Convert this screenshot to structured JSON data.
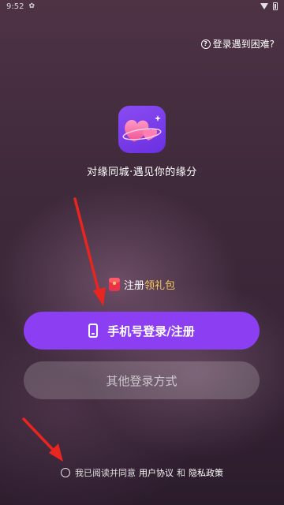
{
  "status_bar": {
    "time": "9:52"
  },
  "help": {
    "icon": "?",
    "label": "登录遇到困难?"
  },
  "app": {
    "tagline": "对缘同城·遇见你的缘分"
  },
  "bonus": {
    "prefix": "注册",
    "highlight": "领礼包"
  },
  "buttons": {
    "phone_login": "手机号登录/注册",
    "other_login": "其他登录方式"
  },
  "agreement": {
    "prefix": "我已阅读并同意",
    "user_agreement": "用户协议",
    "conjunction": "和",
    "privacy_policy": "隐私政策"
  },
  "colors": {
    "primary_button": "#8c3ef2",
    "highlight_text": "#f7c95a",
    "annotation_arrow": "#e8251f"
  }
}
